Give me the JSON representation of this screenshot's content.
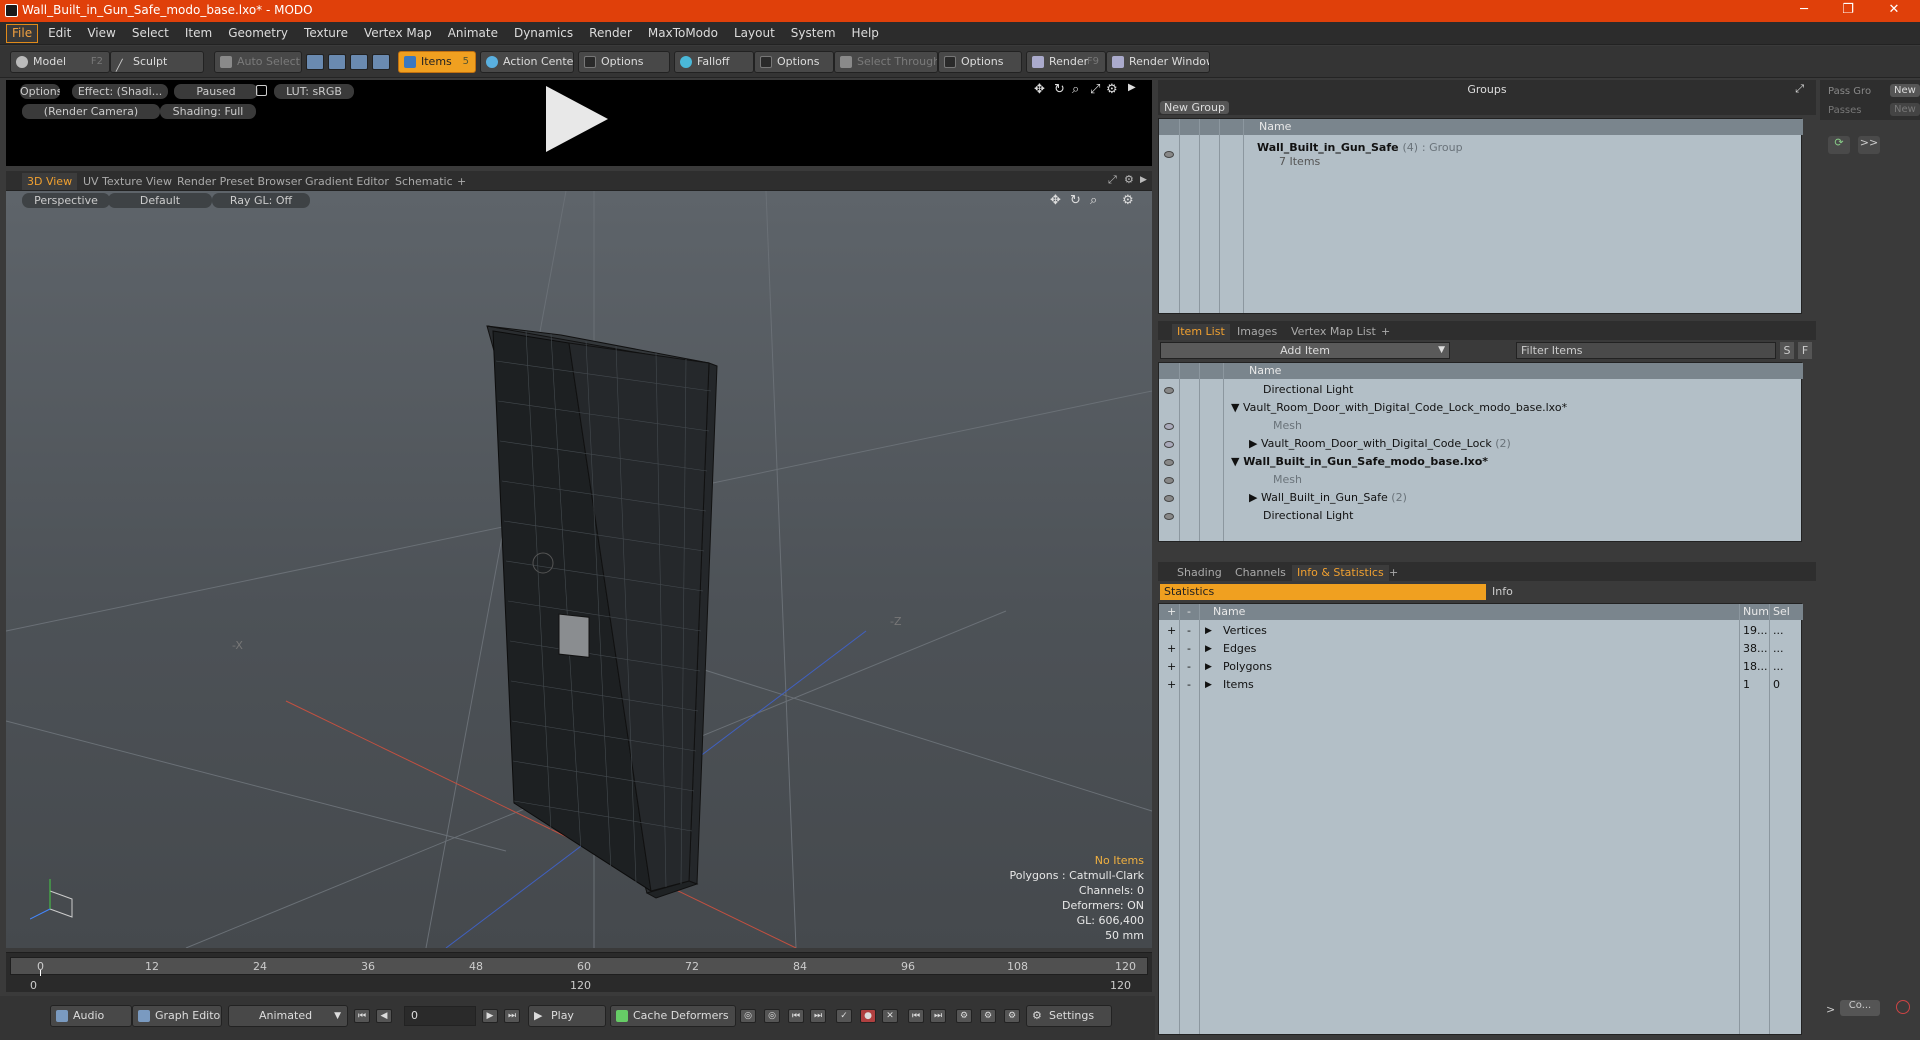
{
  "window": {
    "title": "Wall_Built_in_Gun_Safe_modo_base.lxo* - MODO",
    "minimize": "─",
    "maximize": "❐",
    "close": "✕"
  },
  "menu": [
    "File",
    "Edit",
    "View",
    "Select",
    "Item",
    "Geometry",
    "Texture",
    "Vertex Map",
    "Animate",
    "Dynamics",
    "Render",
    "MaxToModo",
    "Layout",
    "System",
    "Help"
  ],
  "toolbar": {
    "model": "Model",
    "model_key": "F2",
    "sculpt": "Sculpt",
    "auto_select": "Auto Select",
    "items": "Items",
    "items_key": "5",
    "action_center": "Action Center",
    "options1": "Options",
    "falloff": "Falloff",
    "options2": "Options",
    "select_through": "Select Through",
    "options3": "Options",
    "render": "Render",
    "render_key": "F9",
    "render_window": "Render Window"
  },
  "preview": {
    "options": "Options",
    "effect": "Effect: (Shadi...",
    "paused": "Paused",
    "lut": "LUT: sRGB",
    "camera": "(Render Camera)",
    "shading": "Shading: Full"
  },
  "viewport_tabs": [
    "3D View",
    "UV Texture View",
    "Render Preset Browser",
    "Gradient Editor",
    "Schematic",
    "+"
  ],
  "viewport": {
    "perspective": "Perspective",
    "default": "Default",
    "raygl": "Ray GL: Off",
    "axis_x": "-X",
    "axis_z": "-Z",
    "info": {
      "no_items": "No Items",
      "polygons": "Polygons : Catmull-Clark",
      "channels": "Channels: 0",
      "deformers": "Deformers: ON",
      "gl": "GL: 606,400",
      "focal": "50 mm"
    },
    "colors": {
      "no_items": "#f0b040"
    }
  },
  "timeline": {
    "ticks": [
      "0",
      "12",
      "24",
      "36",
      "48",
      "60",
      "72",
      "84",
      "96",
      "108",
      "120"
    ],
    "lower_left": "0",
    "lower_mid": "120",
    "lower_right": "120"
  },
  "bottombar": {
    "audio": "Audio",
    "graph_editor": "Graph Editor",
    "animated": "Animated",
    "frame": "0",
    "play": "Play",
    "cache_deformers": "Cache Deformers",
    "settings": "Settings"
  },
  "groups": {
    "title": "Groups",
    "new_group": "New Group",
    "col_name": "Name",
    "item_name": "Wall_Built_in_Gun_Safe",
    "item_count": "(4)",
    "item_type": ": Group",
    "item_sub": "7 Items"
  },
  "passes": {
    "pass_label": "Pass Gro",
    "pass_new": "New",
    "passes_label": "Passes",
    "passes_new": "New",
    "more": ">>"
  },
  "itemlist": {
    "tabs": [
      "Item List",
      "Images",
      "Vertex Map List",
      "+"
    ],
    "add_item": "Add Item",
    "filter": "Filter Items",
    "s": "S",
    "f": "F",
    "col_name": "Name",
    "rows": [
      {
        "label": "Directional Light",
        "extra": ""
      },
      {
        "label": "Vault_Room_Door_with_Digital_Code_Lock_modo_base.lxo*",
        "extra": ""
      },
      {
        "label": "Mesh",
        "extra": ""
      },
      {
        "label": "Vault_Room_Door_with_Digital_Code_Lock",
        "extra": "(2)"
      },
      {
        "label": "Wall_Built_in_Gun_Safe_modo_base.lxo*",
        "extra": ""
      },
      {
        "label": "Mesh",
        "extra": ""
      },
      {
        "label": "Wall_Built_in_Gun_Safe",
        "extra": "(2)"
      },
      {
        "label": "Directional Light",
        "extra": ""
      }
    ]
  },
  "stats": {
    "tabs": [
      "Shading",
      "Channels",
      "Info & Statistics",
      "+"
    ],
    "statistics": "Statistics",
    "info": "Info",
    "col_name": "Name",
    "col_num": "Num",
    "col_sel": "Sel",
    "rows": [
      {
        "name": "Vertices",
        "num": "19...",
        "sel": "..."
      },
      {
        "name": "Edges",
        "num": "38...",
        "sel": "..."
      },
      {
        "name": "Polygons",
        "num": "18...",
        "sel": "..."
      },
      {
        "name": "Items",
        "num": "1",
        "sel": "0"
      }
    ]
  },
  "far_right": {
    "co": "Co..."
  }
}
